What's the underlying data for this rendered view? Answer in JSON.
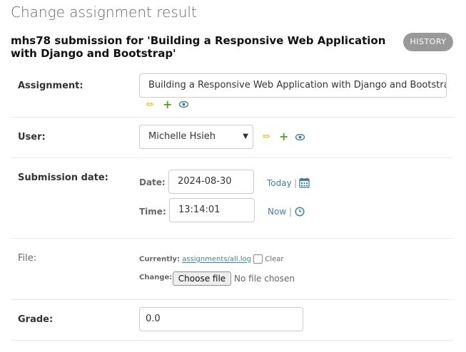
{
  "page": {
    "title": "Change assignment result",
    "subtitle": "mhs78 submission for 'Building a Responsive Web Application with Django and Bootstrap'",
    "history_label": "History"
  },
  "fields": {
    "assignment": {
      "label": "Assignment:",
      "value": "Building a Responsive Web Application with Django and Bootstrap",
      "icons": [
        "pencil-icon",
        "plus-icon",
        "eye-icon"
      ]
    },
    "user": {
      "label": "User:",
      "value": "Michelle Hsieh",
      "icons": [
        "pencil-icon",
        "plus-icon",
        "eye-icon"
      ]
    },
    "submission_date": {
      "label": "Submission date:",
      "date_label": "Date:",
      "date_value": "2024-08-30",
      "today_link": "Today",
      "time_label": "Time:",
      "time_value": "13:14:01",
      "now_link": "Now",
      "separator": "|"
    },
    "file": {
      "label": "File:",
      "currently_label": "Currently:",
      "current_file": "assignments/all.log",
      "clear_label": "Clear",
      "change_label": "Change:",
      "choose_button": "Choose file",
      "no_file_text": "No file chosen"
    },
    "grade": {
      "label": "Grade:",
      "value": "0.0"
    }
  },
  "colors": {
    "link": "#447e9b",
    "history_bg": "#999999",
    "pencil": "#e3b600",
    "plus": "#5aa02c"
  }
}
